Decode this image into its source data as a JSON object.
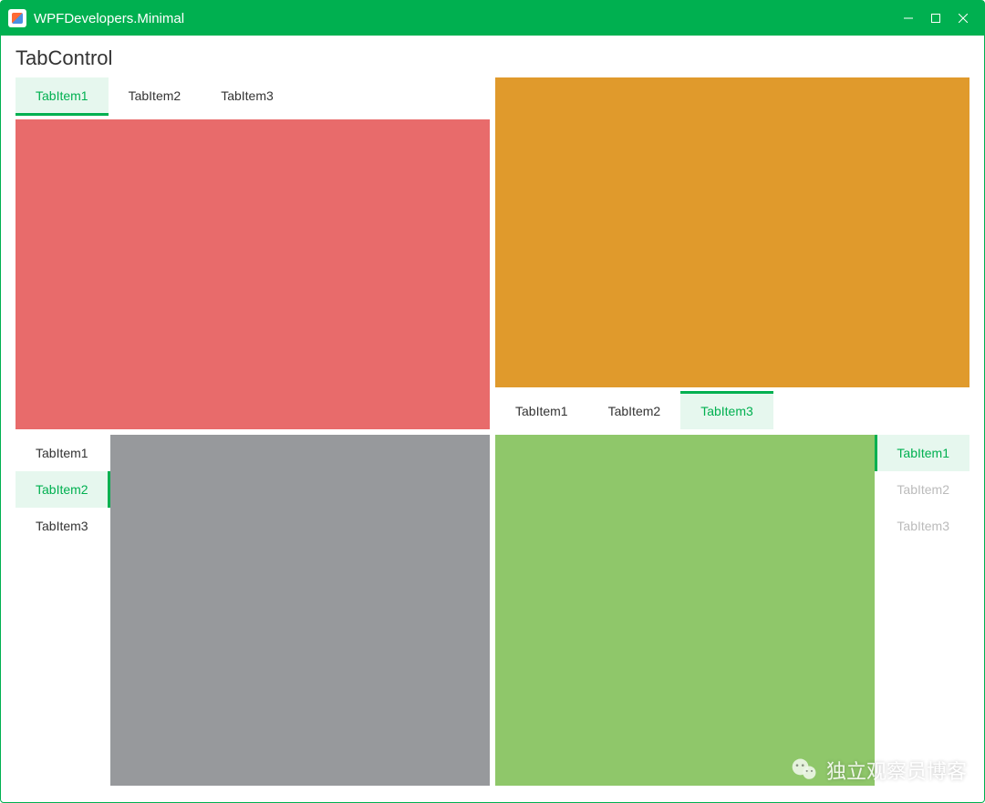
{
  "app": {
    "title": "WPFDevelopers.Minimal"
  },
  "page": {
    "title": "TabControl"
  },
  "tabcontrols": {
    "topleft": {
      "position": "top",
      "tabs": [
        {
          "label": "TabItem1",
          "active": true
        },
        {
          "label": "TabItem2",
          "active": false
        },
        {
          "label": "TabItem3",
          "active": false
        }
      ],
      "content_color": "#e86b6b"
    },
    "topright": {
      "position": "bottom",
      "tabs": [
        {
          "label": "TabItem1",
          "active": false
        },
        {
          "label": "TabItem2",
          "active": false
        },
        {
          "label": "TabItem3",
          "active": true
        }
      ],
      "content_color": "#e09a2c"
    },
    "bottomleft": {
      "position": "left",
      "tabs": [
        {
          "label": "TabItem1",
          "active": false
        },
        {
          "label": "TabItem2",
          "active": true
        },
        {
          "label": "TabItem3",
          "active": false
        }
      ],
      "content_color": "#97999c"
    },
    "bottomright": {
      "position": "right",
      "tabs": [
        {
          "label": "TabItem1",
          "active": true
        },
        {
          "label": "TabItem2",
          "active": false,
          "disabled": true
        },
        {
          "label": "TabItem3",
          "active": false,
          "disabled": true
        }
      ],
      "content_color": "#8fc76a"
    }
  },
  "watermark": {
    "text": "独立观察员博客"
  }
}
